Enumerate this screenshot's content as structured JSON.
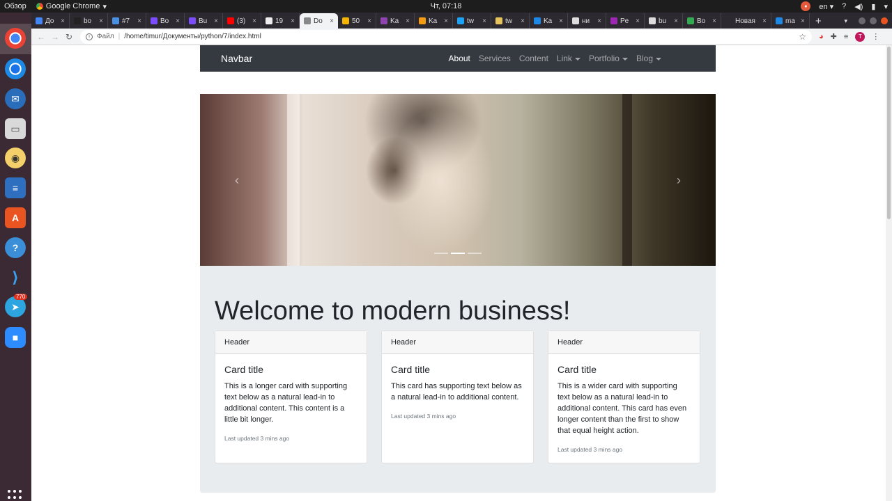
{
  "os": {
    "activities": "Обзор",
    "app_name": "Google Chrome",
    "clock": "Чт, 07:18",
    "lang": "en",
    "help": "?",
    "telegram_badge": "770"
  },
  "browser": {
    "tabs": [
      {
        "label": "До",
        "color": "#4285f4"
      },
      {
        "label": "bo",
        "color": "#222222"
      },
      {
        "label": "#7",
        "color": "#4a90e2"
      },
      {
        "label": "Bo",
        "color": "#7c4dff"
      },
      {
        "label": "Bu",
        "color": "#7c4dff"
      },
      {
        "label": "(3)",
        "color": "#ff0000"
      },
      {
        "label": "19",
        "color": "#eeeeee"
      },
      {
        "label": "Do",
        "color": "#888888",
        "active": true
      },
      {
        "label": "50",
        "color": "#f4b400"
      },
      {
        "label": "Ka",
        "color": "#8e44ad"
      },
      {
        "label": "Ka",
        "color": "#f39c12"
      },
      {
        "label": "tw",
        "color": "#1da1f2"
      },
      {
        "label": "tw",
        "color": "#e6c35c"
      },
      {
        "label": "Ka",
        "color": "#1e88e5"
      },
      {
        "label": "ни",
        "color": "#dddddd"
      },
      {
        "label": "Pe",
        "color": "#9c27b0"
      },
      {
        "label": "bu",
        "color": "#dddddd"
      },
      {
        "label": "Bo",
        "color": "#34a853"
      },
      {
        "label": "Новая",
        "color": "#2c2a30"
      },
      {
        "label": "ma",
        "color": "#1e88e5"
      }
    ],
    "new_tab": "+",
    "tab_close": "×",
    "address_scheme": "Файл",
    "address_url": "/home/timur/Документы/python/7/index.html",
    "profile_initial": "T"
  },
  "site": {
    "brand": "Navbar",
    "nav_links": [
      {
        "label": "About",
        "active": true,
        "dropdown": false
      },
      {
        "label": "Services",
        "active": false,
        "dropdown": false
      },
      {
        "label": "Content",
        "active": false,
        "dropdown": false
      },
      {
        "label": "Link",
        "active": false,
        "dropdown": true
      },
      {
        "label": "Portfolio",
        "active": false,
        "dropdown": true
      },
      {
        "label": "Blog",
        "active": false,
        "dropdown": true
      }
    ],
    "carousel": {
      "prev": "‹",
      "next": "›",
      "slides": 3,
      "active_slide": 1
    },
    "heading": "Welcome to modern business!",
    "cards": [
      {
        "header": "Header",
        "title": "Card title",
        "text": "This is a longer card with supporting text below as a natural lead-in to additional content. This content is a little bit longer.",
        "updated": "Last updated 3 mins ago"
      },
      {
        "header": "Header",
        "title": "Card title",
        "text": "This card has supporting text below as a natural lead-in to additional content.",
        "updated": "Last updated 3 mins ago"
      },
      {
        "header": "Header",
        "title": "Card title",
        "text": "This is a wider card with supporting text below as a natural lead-in to additional content. This card has even longer content than the first to show that equal height action.",
        "updated": "Last updated 3 mins ago"
      }
    ]
  }
}
